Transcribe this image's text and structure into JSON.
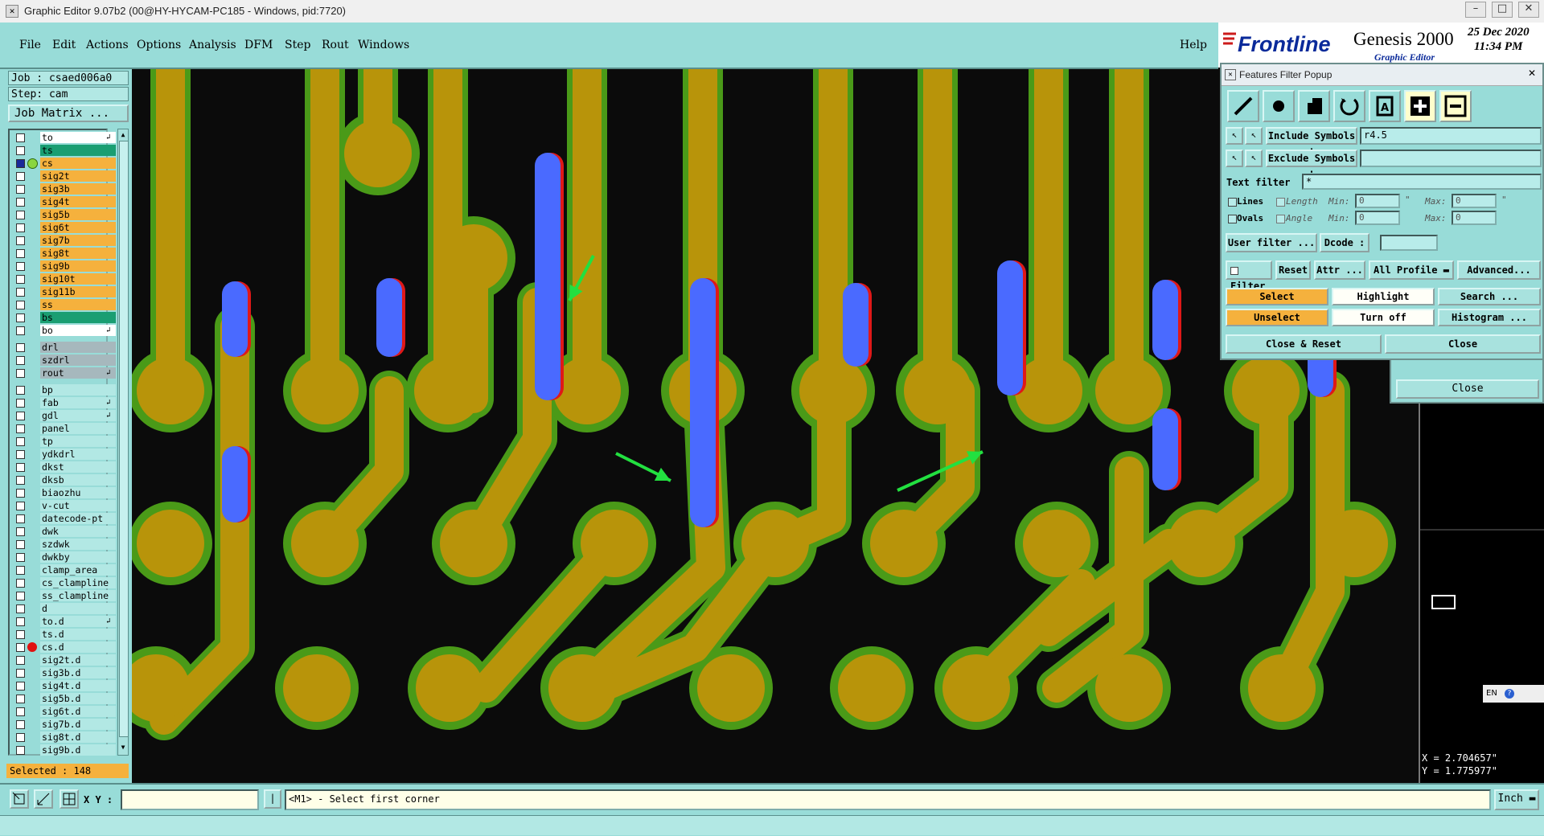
{
  "window": {
    "title": "Graphic Editor 9.07b2 (00@HY-HYCAM-PC185 - Windows, pid:7720)"
  },
  "menu": {
    "items": [
      {
        "label": "File"
      },
      {
        "label": "Edit"
      },
      {
        "label": "Actions"
      },
      {
        "label": "Options"
      },
      {
        "label": "Analysis"
      },
      {
        "label": "DFM"
      },
      {
        "label": "Step"
      },
      {
        "label": "Rout"
      },
      {
        "label": "Windows"
      }
    ],
    "help": "Help"
  },
  "brand": {
    "logo": "Frontline",
    "product": "Genesis 2000",
    "subtitle": "Graphic Editor",
    "date": "25 Dec 2020",
    "time": "11:34 PM"
  },
  "job": {
    "job_label": "Job : csaed006a0",
    "step_label": "Step: cam",
    "matrix_button": "Job Matrix ..."
  },
  "layers": [
    {
      "name": "to",
      "color": "#ffffff",
      "arrow": true
    },
    {
      "name": "ts",
      "color": "#1a9e72"
    },
    {
      "name": "cs",
      "color": "#f5b13d",
      "active": true
    },
    {
      "name": "sig2t",
      "color": "#f5b13d"
    },
    {
      "name": "sig3b",
      "color": "#f5b13d"
    },
    {
      "name": "sig4t",
      "color": "#f5b13d"
    },
    {
      "name": "sig5b",
      "color": "#f5b13d"
    },
    {
      "name": "sig6t",
      "color": "#f5b13d"
    },
    {
      "name": "sig7b",
      "color": "#f5b13d"
    },
    {
      "name": "sig8t",
      "color": "#f5b13d"
    },
    {
      "name": "sig9b",
      "color": "#f5b13d"
    },
    {
      "name": "sig10t",
      "color": "#f5b13d"
    },
    {
      "name": "sig11b",
      "color": "#f5b13d"
    },
    {
      "name": "ss",
      "color": "#f5b13d"
    },
    {
      "name": "bs",
      "color": "#1a9e72"
    },
    {
      "name": "bo",
      "color": "#ffffff",
      "arrow": true
    },
    {
      "name": "drl",
      "color": "#a6b8bd",
      "gap": true
    },
    {
      "name": "szdrl",
      "color": "#a6b8bd"
    },
    {
      "name": "rout",
      "color": "#a6b8bd",
      "arrow": true
    },
    {
      "name": "bp",
      "color": "#b2e8e4",
      "gap": true
    },
    {
      "name": "fab",
      "color": "#b2e8e4",
      "arrow": true
    },
    {
      "name": "gdl",
      "color": "#b2e8e4",
      "arrow": true
    },
    {
      "name": "panel",
      "color": "#b2e8e4"
    },
    {
      "name": "tp",
      "color": "#b2e8e4"
    },
    {
      "name": "ydkdrl",
      "color": "#b2e8e4"
    },
    {
      "name": "dkst",
      "color": "#b2e8e4"
    },
    {
      "name": "dksb",
      "color": "#b2e8e4"
    },
    {
      "name": "biaozhu",
      "color": "#b2e8e4"
    },
    {
      "name": "v-cut",
      "color": "#b2e8e4"
    },
    {
      "name": "datecode-pt",
      "color": "#b2e8e4"
    },
    {
      "name": "dwk",
      "color": "#b2e8e4"
    },
    {
      "name": "szdwk",
      "color": "#b2e8e4"
    },
    {
      "name": "dwkby",
      "color": "#b2e8e4"
    },
    {
      "name": "clamp_area",
      "color": "#b2e8e4"
    },
    {
      "name": "cs_clampline",
      "color": "#b2e8e4"
    },
    {
      "name": "ss_clampline",
      "color": "#b2e8e4"
    },
    {
      "name": "d",
      "color": "#b2e8e4"
    },
    {
      "name": "to.d",
      "color": "#b2e8e4",
      "arrow": true
    },
    {
      "name": "ts.d",
      "color": "#b2e8e4"
    },
    {
      "name": "cs.d",
      "color": "#b2e8e4",
      "dot": true
    },
    {
      "name": "sig2t.d",
      "color": "#b2e8e4"
    },
    {
      "name": "sig3b.d",
      "color": "#b2e8e4"
    },
    {
      "name": "sig4t.d",
      "color": "#b2e8e4"
    },
    {
      "name": "sig5b.d",
      "color": "#b2e8e4"
    },
    {
      "name": "sig6t.d",
      "color": "#b2e8e4"
    },
    {
      "name": "sig7b.d",
      "color": "#b2e8e4"
    },
    {
      "name": "sig8t.d",
      "color": "#b2e8e4"
    },
    {
      "name": "sig9b.d",
      "color": "#b2e8e4"
    }
  ],
  "selection": {
    "label": "Selected : 148"
  },
  "filter_popup": {
    "title": "Features Filter Popup",
    "include_label": "Include Symbols :",
    "include_value": "r4.5",
    "exclude_label": "Exclude Symbols :",
    "exclude_value": "",
    "text_filter_label": "Text filter",
    "text_filter_value": "*",
    "lines_label": "Lines",
    "ovals_label": "Ovals",
    "length_label": "Length",
    "angle_label": "Angle",
    "min_label": "Min:",
    "max_label": "Max:",
    "length_min": "0",
    "length_max": "0",
    "angle_min": "0",
    "angle_max": "0",
    "unit_in": "\"",
    "user_filter": "User filter ...",
    "dcode_label": "Dcode :",
    "filter_label": "Filter",
    "reset": "Reset",
    "attr": "Attr ...",
    "profile": "All Profile",
    "advanced": "Advanced...",
    "select": "Select",
    "highlight": "Highlight",
    "search": "Search ...",
    "unselect": "Unselect",
    "turn_off": "Turn off",
    "histogram": "Histogram ...",
    "close_reset": "Close & Reset",
    "close": "Close"
  },
  "behind_panel": {
    "close": "Close"
  },
  "coords": {
    "x": "X = 2.704657\"",
    "y": "Y = 1.775977\""
  },
  "ime": {
    "lang": "EN"
  },
  "command": {
    "xy_label": "X Y :",
    "xy_value": "",
    "prompt": "<M1> - Select first corner",
    "units": "Inch"
  },
  "colors": {
    "pad": "#b8940a",
    "outline": "#4a9a18",
    "selected": "#4a6aff",
    "background": "#0b0b0b",
    "arrow": "#22e040",
    "panel": "#98dcd8"
  }
}
